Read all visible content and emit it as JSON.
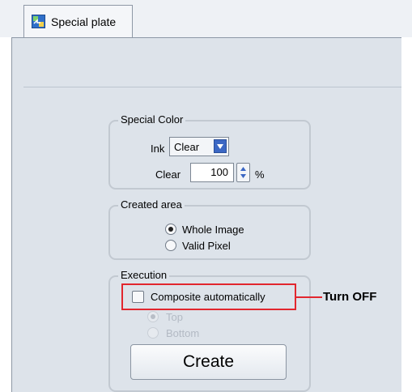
{
  "tab": {
    "label": "Special plate"
  },
  "special_color": {
    "title": "Special Color",
    "ink_label": "Ink",
    "ink_value": "Clear",
    "amount_label": "Clear",
    "amount_value": "100",
    "unit": "%"
  },
  "created_area": {
    "title": "Created area",
    "options": [
      {
        "label": "Whole Image",
        "selected": true
      },
      {
        "label": "Valid Pixel",
        "selected": false
      }
    ]
  },
  "execution": {
    "title": "Execution",
    "composite_label": "Composite automatically",
    "composite_checked": false,
    "position_options": [
      {
        "label": "Top",
        "selected": true,
        "enabled": false
      },
      {
        "label": "Bottom",
        "selected": false,
        "enabled": false
      }
    ],
    "create_label": "Create"
  },
  "annotation": {
    "text": "Turn OFF",
    "color": "#e2262e"
  }
}
